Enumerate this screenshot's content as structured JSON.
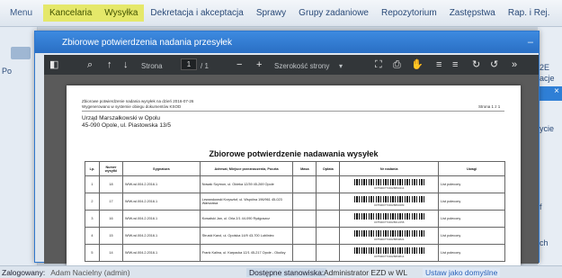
{
  "menu": {
    "items": [
      "Menu",
      "Kancelaria",
      "Wysyłka",
      "Dekretacja i akceptacja",
      "Sprawy",
      "Grupy zadaniowe",
      "Repozytorium",
      "Zastępstwa",
      "Rap. i Rej."
    ]
  },
  "background": {
    "left_label": "Po",
    "right_labels": [
      "2E",
      "acje",
      "ycie",
      "f",
      "ch"
    ]
  },
  "dialog": {
    "title": "Zbiorowe potwierdzenia nadania przesyłek",
    "close": "–"
  },
  "viewer": {
    "page_label": "Strona",
    "page_value": "1",
    "page_total": "/ 1",
    "zoom_label": "Szerokość strony"
  },
  "document": {
    "header_line1": "Zbiorowe potwierdzenie nadania wysyłek na dzień 2016-07-26",
    "header_line2": "Wygenerowano w systemie obiegu dokumentów KSOD",
    "page_number": "Strona 1 z 1",
    "org_name": "Urząd Marszałkowski w Opolu",
    "org_address": "45-090 Opole, ul. Piastowska 13/5",
    "heading": "Zbiorowe potwierdzenie nadawania wysyłek",
    "columns": [
      "Lp.",
      "Numer wysyłki",
      "Sygnatura",
      "Adresat, Miejsce przeznaczenia, Poczta",
      "Masa",
      "Opłata",
      "Nr nadania",
      "Uwagi"
    ],
    "rows": [
      {
        "lp": "1",
        "num": "18",
        "sygn": "WIW-wl.004.2.2016.1",
        "addr": "Nowak Szymon, ul. Okieka 12/39 45-269 Opole",
        "code": "00759007734628860414",
        "uwagi": "List polecony"
      },
      {
        "lp": "2",
        "num": "17",
        "sygn": "WIW-wl.004.2.2016.1",
        "addr": "Lewandowski Krzysztof, ul. Wspólna 196/961 45-023 Warszawa",
        "code": "00759007734628860489",
        "uwagi": "List polecony"
      },
      {
        "lp": "3",
        "num": "16",
        "sygn": "WIW-wl.004.2.2016.1",
        "addr": "Kowalski Jan, ul. Orla 2/1 44-090 Rydgoszcz",
        "code": "00759007734628612458",
        "uwagi": "List polecony"
      },
      {
        "lp": "4",
        "num": "15",
        "sygn": "WIW-wl.004.2.2016.1",
        "addr": "Struski Karol, ul. Opolska 14/9 43-700 Lubliniec",
        "code": "00759007734628869824",
        "uwagi": "List polecony"
      },
      {
        "lp": "5",
        "num": "14",
        "sygn": "WIW-wl.004.2.2016.1",
        "addr": "Frank Kalina, ul. Karpacka 12/1 45-217 Opole - Okolicy",
        "code": "00759007734628869814",
        "uwagi": "List polecony"
      }
    ]
  },
  "status": {
    "logged_label": "Zalogowany:",
    "logged_user": "Adam Nacielny (admin)",
    "station_label": "Dostępne stanowiska:",
    "station_value": "Administrator EZD w WL",
    "default_link": "Ustaw jako domyślne"
  },
  "colors": {
    "accent": "#2f77cc",
    "highlight": "#e5e86a",
    "viewer_toolbar": "#323639"
  }
}
